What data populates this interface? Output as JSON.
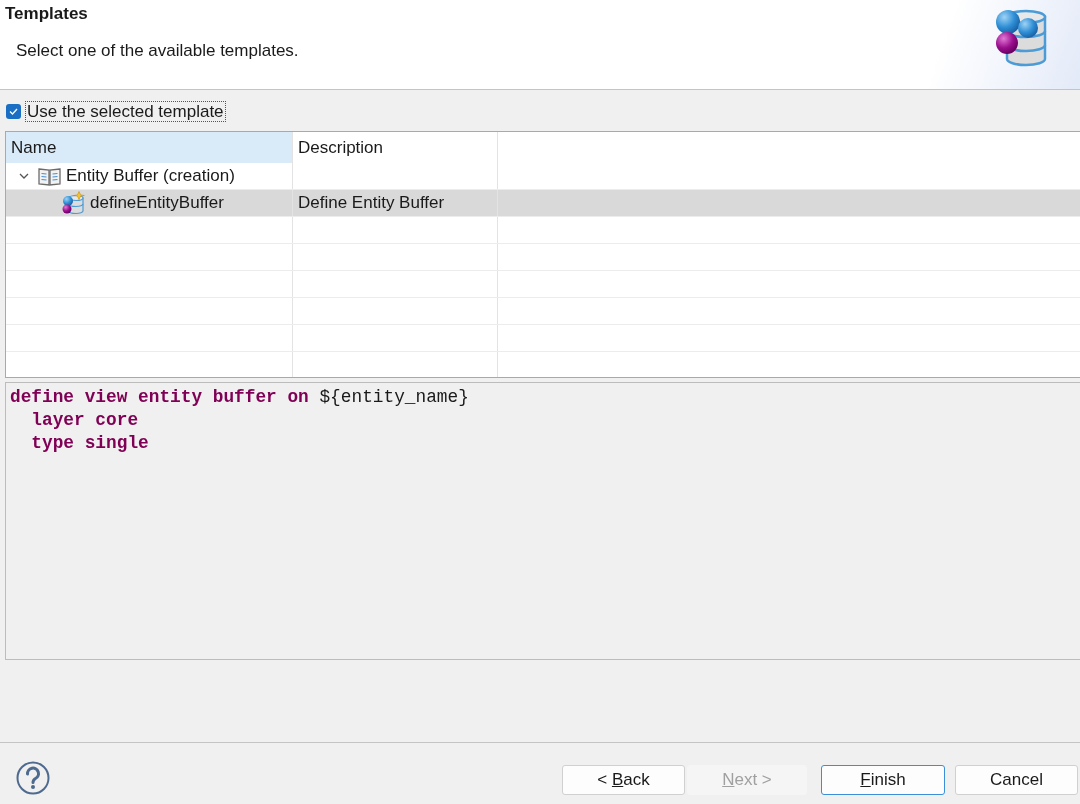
{
  "header": {
    "title": "Templates",
    "message": "Select one of the available templates."
  },
  "use_selected_template": {
    "label": "Use the selected template",
    "checked": true,
    "focused": true
  },
  "table": {
    "columns": [
      {
        "label": "Name",
        "highlighted": true
      },
      {
        "label": "Description",
        "highlighted": false
      }
    ],
    "rows": [
      {
        "kind": "category",
        "name": "Entity Buffer (creation)",
        "expanded": true,
        "selected": false,
        "children": [
          {
            "kind": "template",
            "name": "defineEntityBuffer",
            "description": "Define Entity Buffer",
            "selected": true
          }
        ]
      }
    ]
  },
  "preview": {
    "lines": [
      [
        {
          "kind": "keyword",
          "text": "define view entity buffer on "
        },
        {
          "kind": "plain",
          "text": "${entity_name}"
        }
      ],
      [
        {
          "kind": "keyword",
          "text": "  layer core"
        }
      ],
      [
        {
          "kind": "keyword",
          "text": "  type single"
        }
      ]
    ]
  },
  "buttons": [
    {
      "kind": "back",
      "label_start": "< ",
      "mnemonic": "B",
      "label_end": "ack",
      "disabled": false,
      "default": false
    },
    {
      "kind": "next",
      "mnemonic": "N",
      "label_end": "ext >",
      "disabled": true,
      "default": false
    },
    {
      "kind": "finish",
      "mnemonic": "F",
      "label_end": "inish",
      "disabled": false,
      "default": true
    },
    {
      "kind": "cancel",
      "label_start": "Cancel",
      "disabled": false,
      "default": false
    }
  ]
}
